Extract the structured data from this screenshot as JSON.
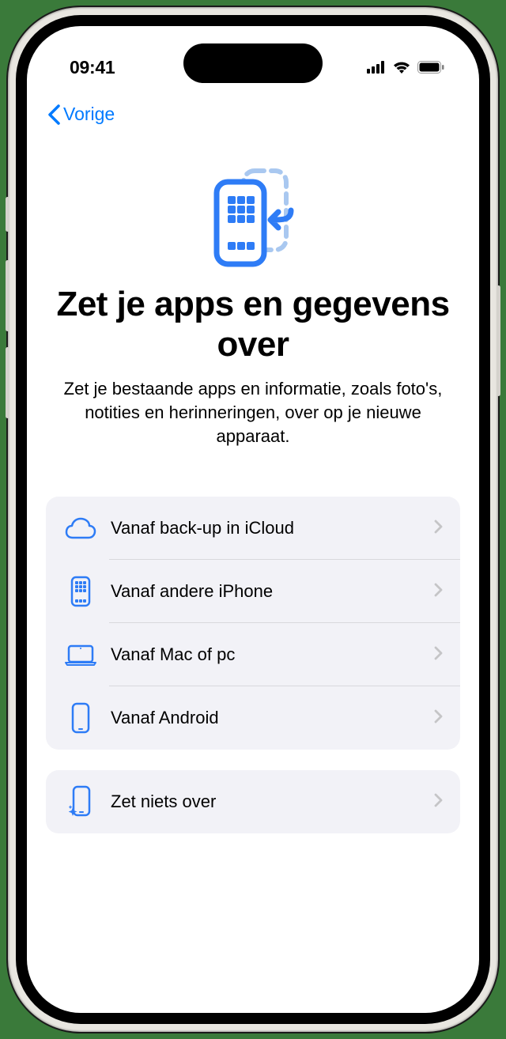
{
  "statusBar": {
    "time": "09:41"
  },
  "nav": {
    "back": "Vorige"
  },
  "header": {
    "title": "Zet je apps en gegevens over",
    "subtitle": "Zet je bestaande apps en informatie, zoals foto's, notities en herinneringen, over op je nieuwe apparaat."
  },
  "options": [
    {
      "label": "Vanaf back-up in iCloud"
    },
    {
      "label": "Vanaf andere iPhone"
    },
    {
      "label": "Vanaf Mac of pc"
    },
    {
      "label": "Vanaf Android"
    }
  ],
  "secondary": [
    {
      "label": "Zet niets over"
    }
  ]
}
